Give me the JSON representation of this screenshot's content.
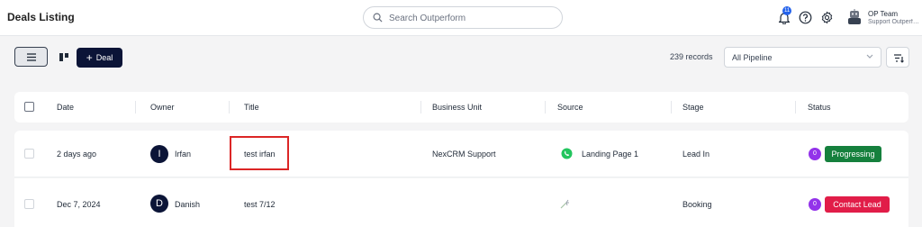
{
  "header": {
    "title": "Deals Listing",
    "search_placeholder": "Search Outperform",
    "notification_count": "11",
    "user": {
      "name": "OP Team",
      "subtitle": "Support Outperform"
    }
  },
  "toolbar": {
    "add_deal_label": "Deal",
    "records_text": "239 records",
    "pipeline_value": "All Pipeline"
  },
  "table": {
    "columns": [
      "Date",
      "Owner",
      "Title",
      "Business Unit",
      "Source",
      "Stage",
      "Status"
    ],
    "rows": [
      {
        "date": "2 days ago",
        "owner_initial": "I",
        "owner": "Irfan",
        "title": "test irfan",
        "business_unit": "NexCRM Support",
        "source": "Landing Page 1",
        "stage": "Lead In",
        "status_count": "0",
        "status": "Progressing",
        "status_color": "#15803d"
      },
      {
        "date": "Dec 7, 2024",
        "owner_initial": "D",
        "owner": "Danish",
        "title": "test 7/12",
        "business_unit": "",
        "source": "",
        "stage": "Booking",
        "status_count": "0",
        "status": "Contact Lead",
        "status_color": "#e11d48"
      }
    ]
  },
  "colors": {
    "brand_dark": "#0b1437",
    "accent_blue": "#2563eb",
    "highlight": "#dc2626"
  }
}
